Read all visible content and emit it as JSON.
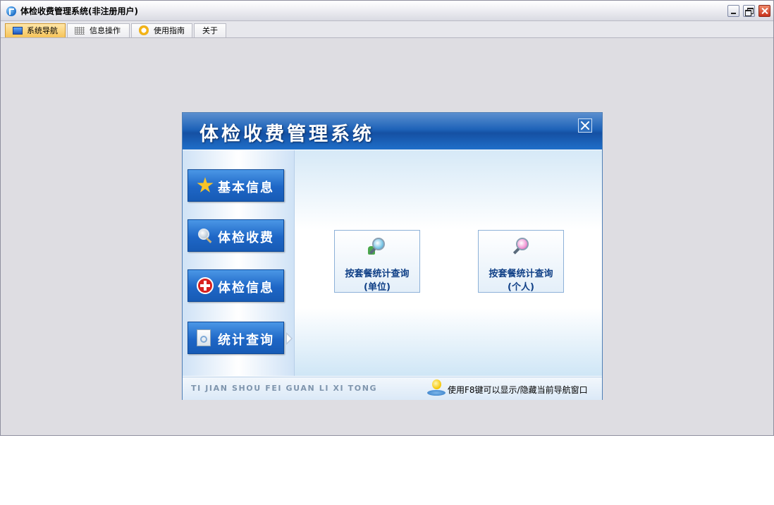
{
  "window": {
    "title": "体检收费管理系统(非注册用户)"
  },
  "tabs": [
    {
      "label": "系统导航",
      "icon": "monitor-icon",
      "active": true
    },
    {
      "label": "信息操作",
      "icon": "grid-icon",
      "active": false
    },
    {
      "label": "使用指南",
      "icon": "help-ring-icon",
      "active": false
    },
    {
      "label": "关于",
      "icon": "",
      "active": false
    }
  ],
  "dialog": {
    "title": "体检收费管理系统",
    "nav": [
      {
        "label": "基本信息",
        "icon": "star-icon"
      },
      {
        "label": "体检收费",
        "icon": "search-icon"
      },
      {
        "label": "体检信息",
        "icon": "medical-cross-icon"
      },
      {
        "label": "统计查询",
        "icon": "document-search-icon",
        "selected": true
      }
    ],
    "queries": [
      {
        "line1": "按套餐统计查询",
        "line2": "(单位)",
        "icon": "group-search-icon"
      },
      {
        "line1": "按套餐统计查询",
        "line2": "(个人)",
        "icon": "person-search-icon"
      }
    ],
    "footer": {
      "roman": "TI JIAN SHOU FEI GUAN LI XI TONG",
      "tip": "使用F8键可以显示/隐藏当前导航窗口"
    }
  },
  "colors": {
    "accent": "#1e63b8",
    "tab_active": "#f6c45a",
    "client_bg": "#dedde2"
  }
}
